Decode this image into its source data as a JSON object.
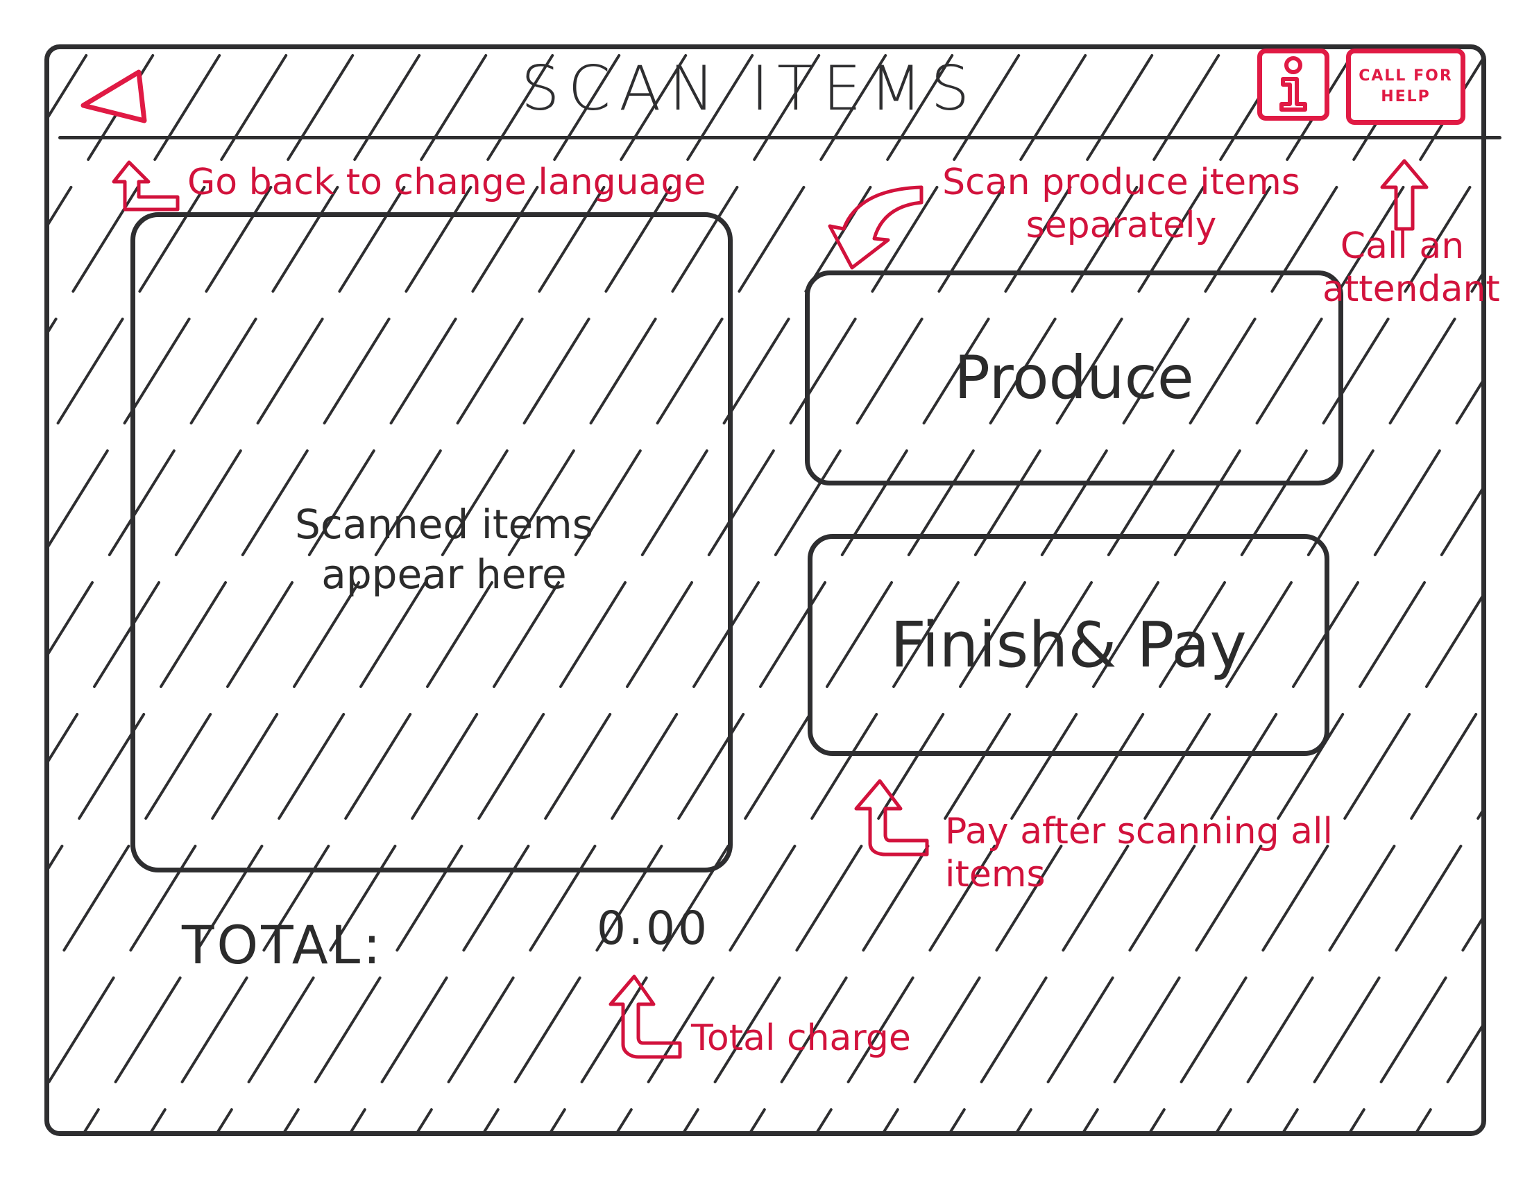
{
  "header": {
    "title": "SCAN ITEMS",
    "help_label": "CALL FOR HELP"
  },
  "scan_area": {
    "placeholder": "Scanned items appear here"
  },
  "buttons": {
    "produce": "Produce",
    "finish_pay": "Finish& Pay"
  },
  "total": {
    "label": "TOTAL:",
    "value": "0.00"
  },
  "annotations": {
    "back": "Go back to change language",
    "produce": "Scan produce items separately",
    "help": "Call an attendant",
    "pay": "Pay after scanning all items",
    "total": "Total charge"
  },
  "icons": {
    "back": "back-triangle-icon",
    "info": "info-icon"
  },
  "colors": {
    "ink": "#2e2e30",
    "accent": "#e01a44",
    "annotation": "#d2123c"
  }
}
